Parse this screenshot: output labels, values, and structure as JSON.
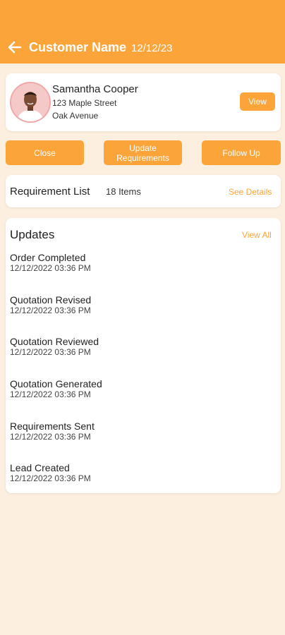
{
  "header": {
    "title": "Customer Name",
    "date": "12/12/23",
    "back_icon": "arrow-left-icon",
    "background": "#fba43a"
  },
  "profile": {
    "name": "Samantha Cooper",
    "address_line1": "123 Maple Street",
    "address_line2": "Oak Avenue",
    "view_label": "View"
  },
  "actions": {
    "close_label": "Close",
    "update_label_line1": "Update",
    "update_label_line2": "Requirements",
    "follow_up_label": "Follow Up"
  },
  "requirements": {
    "title": "Requirement List",
    "count": "18 Items",
    "details_label": "See Details"
  },
  "updates": {
    "title": "Updates",
    "view_all_label": "View All",
    "items": [
      {
        "name": "Order Completed",
        "time": "12/12/2022 03:36 PM"
      },
      {
        "name": "Quotation Revised",
        "time": "12/12/2022 03:36 PM"
      },
      {
        "name": "Quotation Reviewed",
        "time": "12/12/2022 03:36 PM"
      },
      {
        "name": "Quotation Generated",
        "time": "12/12/2022 03:36 PM"
      },
      {
        "name": "Requirements Sent",
        "time": "12/12/2022 03:36 PM"
      },
      {
        "name": "Lead Created",
        "time": "12/12/2022 03:36 PM"
      }
    ]
  },
  "colors": {
    "accent": "#fba43a",
    "background": "#fcefdf",
    "card": "#ffffff"
  }
}
